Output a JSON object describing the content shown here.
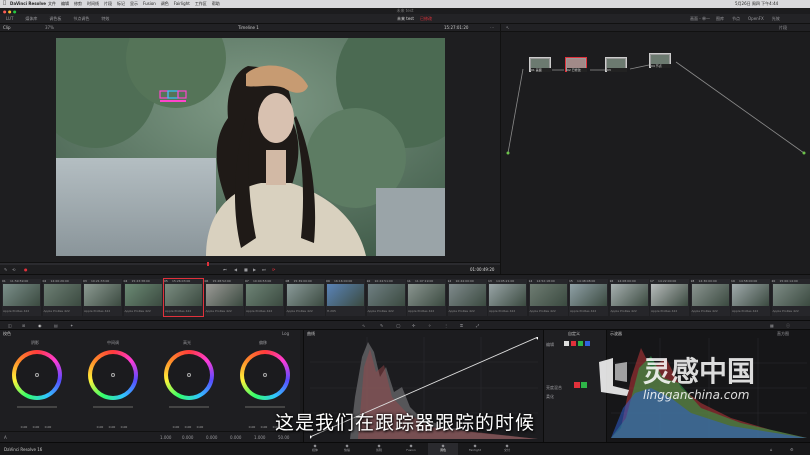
{
  "mac_menu": {
    "app": "DaVinci Resolve",
    "items": [
      "文件",
      "编辑",
      "修剪",
      "时间线",
      "片段",
      "标记",
      "显示",
      "Fusion",
      "调色",
      "Fairlight",
      "工作区",
      "帮助"
    ],
    "clock": "5月26日 周四 下午4:44"
  },
  "window_title": "未来 test",
  "toolbar": {
    "left": [
      "LUT",
      "媒体库",
      "调色板",
      "节点调色",
      "特效"
    ],
    "project": "未来 test",
    "edited": "已修改",
    "right": [
      "图库",
      "节点",
      "OpenFX",
      "光效"
    ],
    "layout": "画面 - 单一"
  },
  "viewer": {
    "clip_dropdown": "Clip",
    "timeline_name": "Timeline 1",
    "timecode_top": "15:27:01:20",
    "zoom": "37%",
    "timecode_bottom": "01:00:49:20"
  },
  "nodes_panel": {
    "mode": "片段",
    "nodes": [
      "01 画面",
      "02 已修改",
      "03",
      "04 节点"
    ]
  },
  "clips": [
    {
      "num": "01",
      "tc": "11:59:59:00",
      "codec": "Apple ProRes 422"
    },
    {
      "num": "02",
      "tc": "14:00:26:00",
      "codec": "Apple ProRes 422"
    },
    {
      "num": "03",
      "tc": "10:21:33:00",
      "codec": "Apple ProRes 422"
    },
    {
      "num": "04",
      "tc": "15:23:38:00",
      "codec": "Apple ProRes 422"
    },
    {
      "num": "05",
      "tc": "15:26:03:00",
      "codec": "Apple ProRes 422"
    },
    {
      "num": "06",
      "tc": "15:28:52:00",
      "codec": "Apple ProRes 422"
    },
    {
      "num": "07",
      "tc": "10:04:53:00",
      "codec": "Apple ProRes 422"
    },
    {
      "num": "08",
      "tc": "15:39:00:00",
      "codec": "Apple ProRes 422"
    },
    {
      "num": "09",
      "tc": "16:16:00:00",
      "codec": "H.265"
    },
    {
      "num": "10",
      "tc": "10:24:51:00",
      "codec": "Apple ProRes 422"
    },
    {
      "num": "11",
      "tc": "11:07:19:00",
      "codec": "Apple ProRes 422"
    },
    {
      "num": "12",
      "tc": "10:44:00:00",
      "codec": "Apple ProRes 422"
    },
    {
      "num": "13",
      "tc": "14:05:21:00",
      "codec": "Apple ProRes 422"
    },
    {
      "num": "14",
      "tc": "14:52:18:00",
      "codec": "Apple ProRes 422"
    },
    {
      "num": "15",
      "tc": "14:48:08:00",
      "codec": "Apple ProRes 422"
    },
    {
      "num": "16",
      "tc": "14:08:00:00",
      "codec": "Apple ProRes 422"
    },
    {
      "num": "17",
      "tc": "14:22:00:00",
      "codec": "Apple ProRes 422"
    },
    {
      "num": "18",
      "tc": "14:30:00:00",
      "codec": "Apple ProRes 422"
    },
    {
      "num": "19",
      "tc": "14:58:00:00",
      "codec": "Apple ProRes 422"
    },
    {
      "num": "20",
      "tc": "15:00:14:00",
      "codec": "Apple ProRes 422"
    }
  ],
  "wheels_panel": {
    "title": "校色",
    "mode": "Log",
    "wheels": [
      {
        "label": "阴影"
      },
      {
        "label": "中间调"
      },
      {
        "label": "高光"
      },
      {
        "label": "偏移"
      }
    ],
    "values": [
      "0.00",
      "0.00",
      "0.00"
    ],
    "footer": {
      "a": "1.000",
      "b": "0.000",
      "c": "0.000",
      "d": "0.000",
      "e": "1.000",
      "f": "50.00"
    }
  },
  "curves_panel": {
    "title": "曲线",
    "side_title": "自定义",
    "side_items": [
      "编辑",
      "亮度混合",
      "柔化"
    ]
  },
  "scope_panel": {
    "title": "示波器",
    "mode": "直方图"
  },
  "subtitle": "这是我们在跟踪器跟踪的时候",
  "watermark": {
    "brand": "灵感中国",
    "url": "lingganchina.com"
  },
  "bottom_nav": {
    "app": "DaVinci Resolve 16",
    "pages": [
      "媒体",
      "快编",
      "剪辑",
      "Fusion",
      "调色",
      "Fairlight",
      "交付"
    ]
  },
  "colors": {
    "accent": "#e1313b",
    "panel": "#1e1e21"
  }
}
